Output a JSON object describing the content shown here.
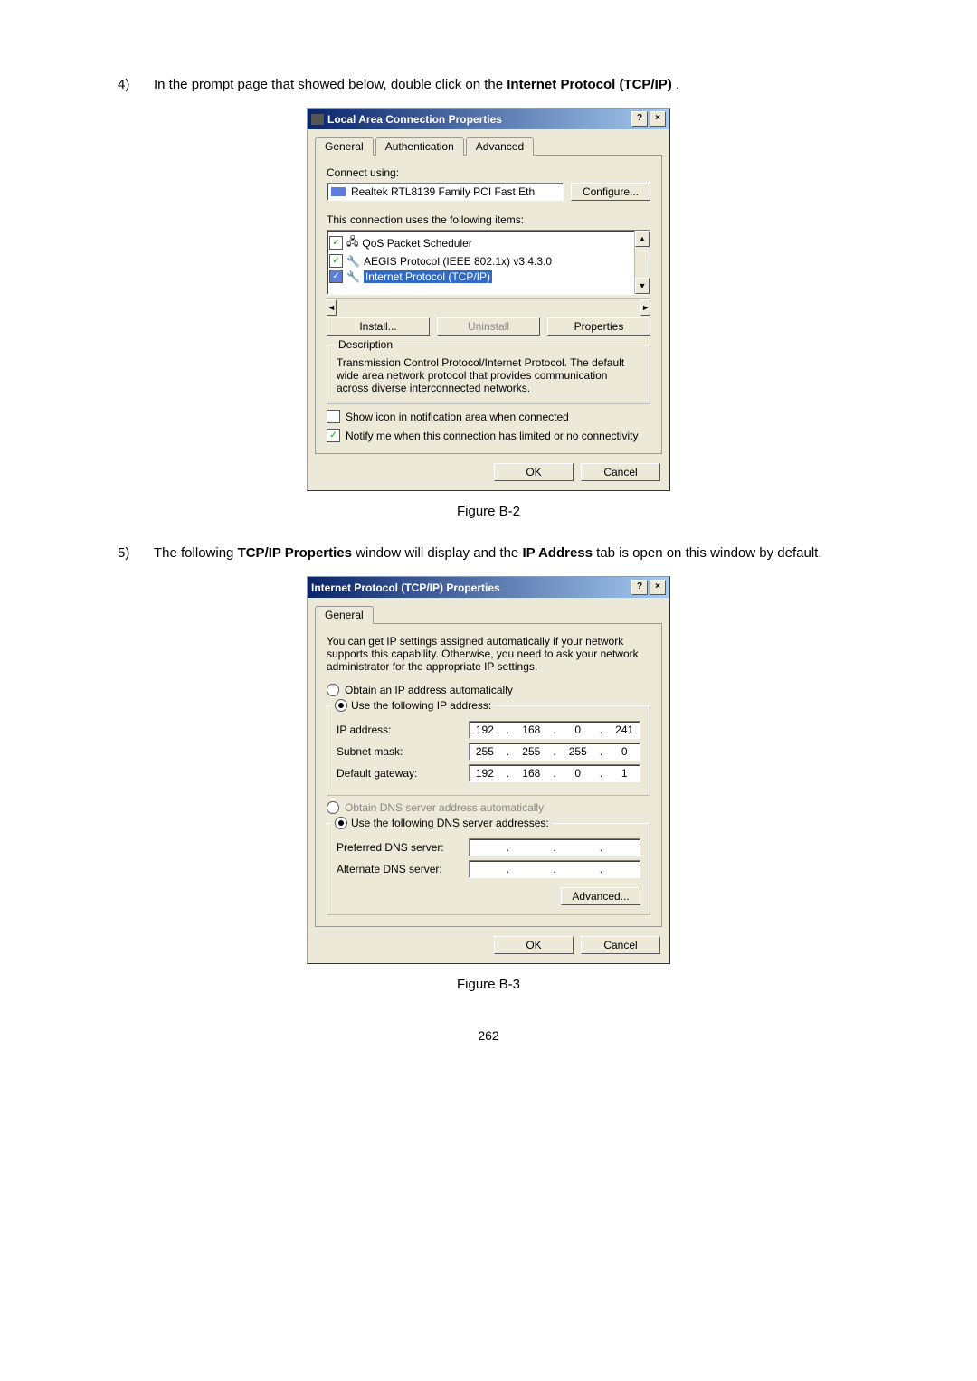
{
  "step4": {
    "num": "4)",
    "t1": "In the prompt page that showed below, double click on the ",
    "bold": "Internet Protocol (TCP/IP)",
    "t2": "."
  },
  "fig1": "Figure B-2",
  "step5": {
    "num": "5)",
    "t1": "The following ",
    "b1": "TCP/IP Properties",
    "t2": " window will display and the ",
    "b2": "IP Address",
    "t3": " tab is open on this window by default."
  },
  "fig2": "Figure B-3",
  "pagenum": "262",
  "dlg1": {
    "title": "Local Area Connection    Properties",
    "tabs": {
      "general": "General",
      "auth": "Authentication",
      "adv": "Advanced"
    },
    "connect_using": "Connect using:",
    "adapter": "Realtek RTL8139 Family PCI Fast Eth",
    "configure": "Configure...",
    "uses": "This connection uses the following items:",
    "item_qos": "QoS Packet Scheduler",
    "item_aegis": "AEGIS Protocol (IEEE 802.1x) v3.4.3.0",
    "item_tcpip": "Internet Protocol (TCP/IP)",
    "install": "Install...",
    "uninstall": "Uninstall",
    "properties": "Properties",
    "desc_title": "Description",
    "desc": "Transmission Control Protocol/Internet Protocol. The default wide area network protocol that provides communication across diverse interconnected networks.",
    "show_icon": "Show icon in notification area when connected",
    "notify": "Notify me when this connection has limited or no connectivity",
    "ok": "OK",
    "cancel": "Cancel"
  },
  "dlg2": {
    "title": "Internet Protocol (TCP/IP) Properties",
    "tab": "General",
    "note": "You can get IP settings assigned automatically if your network supports this capability. Otherwise, you need to ask your network administrator for the appropriate IP settings.",
    "obtain_ip": "Obtain an IP address automatically",
    "use_ip": "Use the following IP address:",
    "ip_label": "IP address:",
    "ip_val": [
      "192",
      "168",
      "0",
      "241"
    ],
    "subnet_label": "Subnet mask:",
    "subnet_val": [
      "255",
      "255",
      "255",
      "0"
    ],
    "gw_label": "Default gateway:",
    "gw_val": [
      "192",
      "168",
      "0",
      "1"
    ],
    "obtain_dns": "Obtain DNS server address automatically",
    "use_dns": "Use the following DNS server addresses:",
    "pref_dns": "Preferred DNS server:",
    "alt_dns": "Alternate DNS server:",
    "advanced": "Advanced...",
    "ok": "OK",
    "cancel": "Cancel"
  }
}
